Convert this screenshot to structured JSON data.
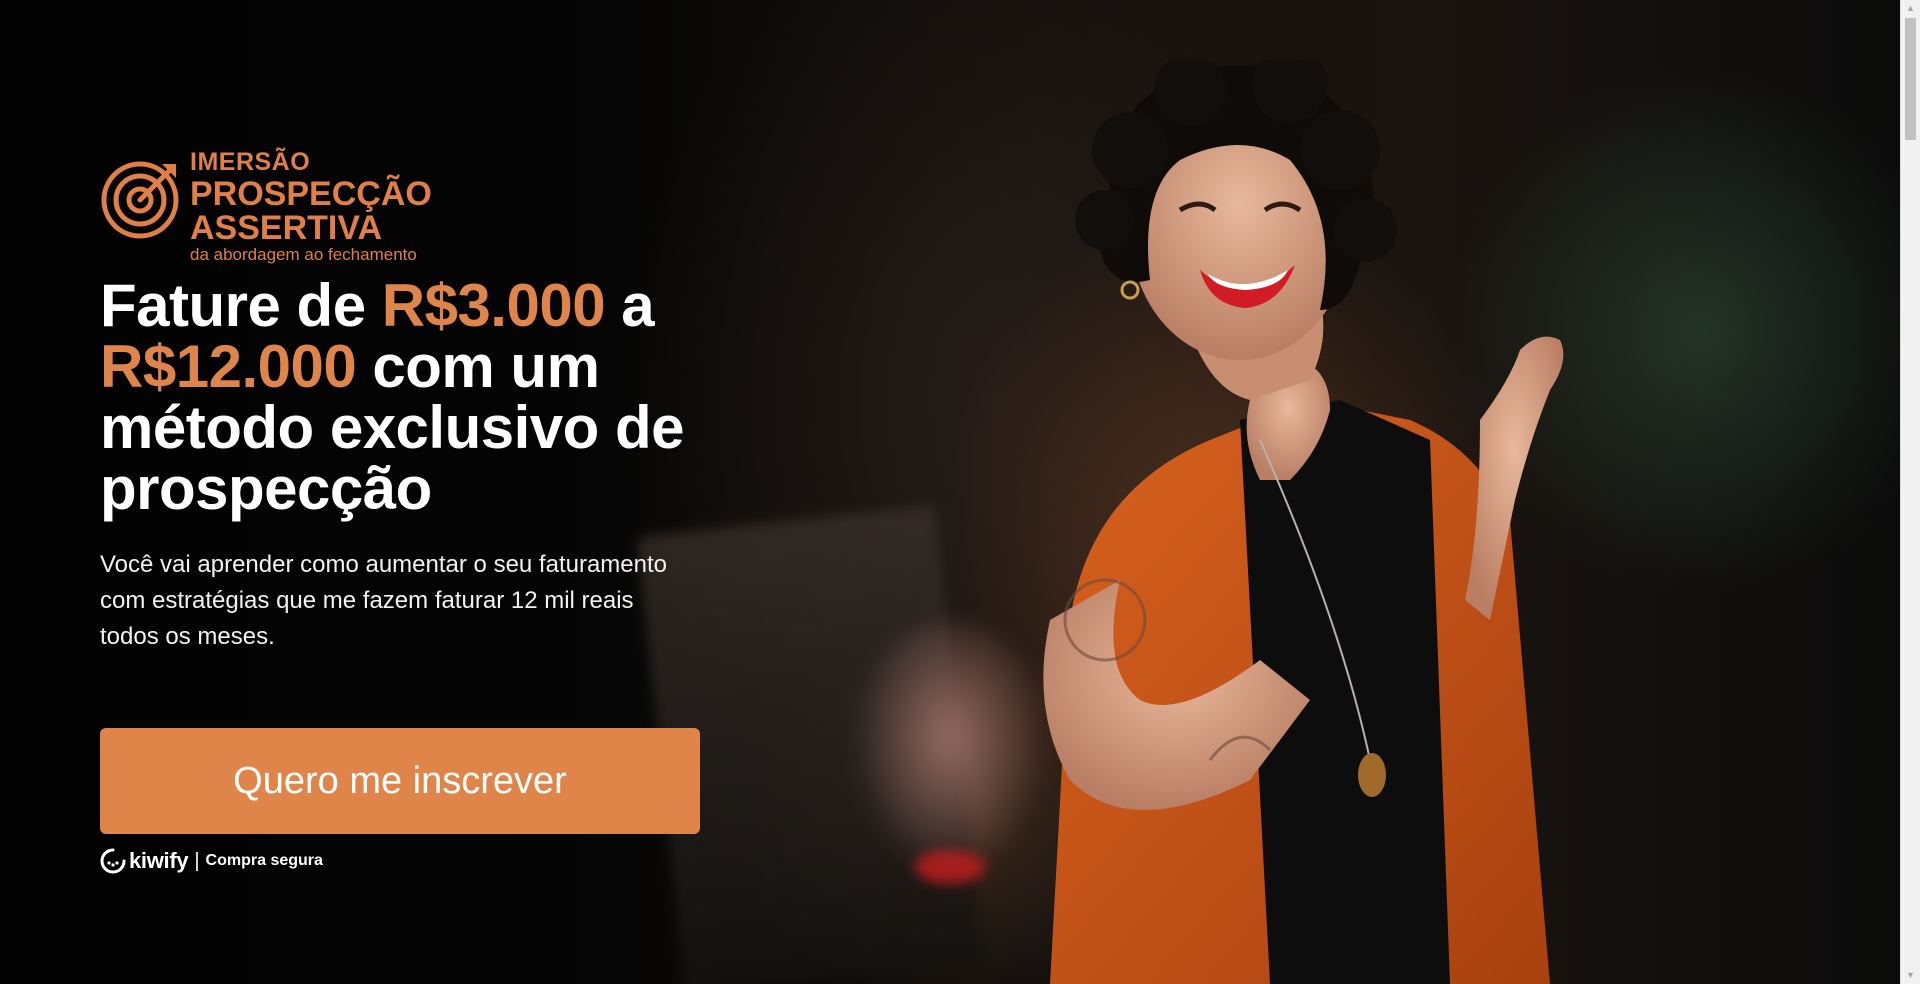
{
  "logo": {
    "line1": "IMERSÃO",
    "line2": "PROSPECÇÃO",
    "line3": "ASSERTIVA",
    "tagline": "da abordagem ao fechamento"
  },
  "headline": {
    "part1": "Fature de ",
    "amount1": "R$3.000",
    "part2": " a ",
    "amount2": "R$12.000",
    "part3": " com um método exclusivo de prospecção"
  },
  "subtext": "Você vai aprender como aumentar o seu faturamento com estratégias que me fazem faturar 12 mil reais todos os meses.",
  "cta": {
    "label": "Quero me inscrever"
  },
  "secure": {
    "brand": "kiwify",
    "separator": "|",
    "label": "Compra segura"
  },
  "colors": {
    "accent": "#e0854a",
    "background": "#050505",
    "text": "#ffffff"
  },
  "icons": {
    "logo": "target-arrow-icon",
    "kiwify": "kiwify-logo-icon",
    "scroll_up": "scroll-up-arrow-icon",
    "scroll_down": "scroll-down-arrow-icon"
  }
}
